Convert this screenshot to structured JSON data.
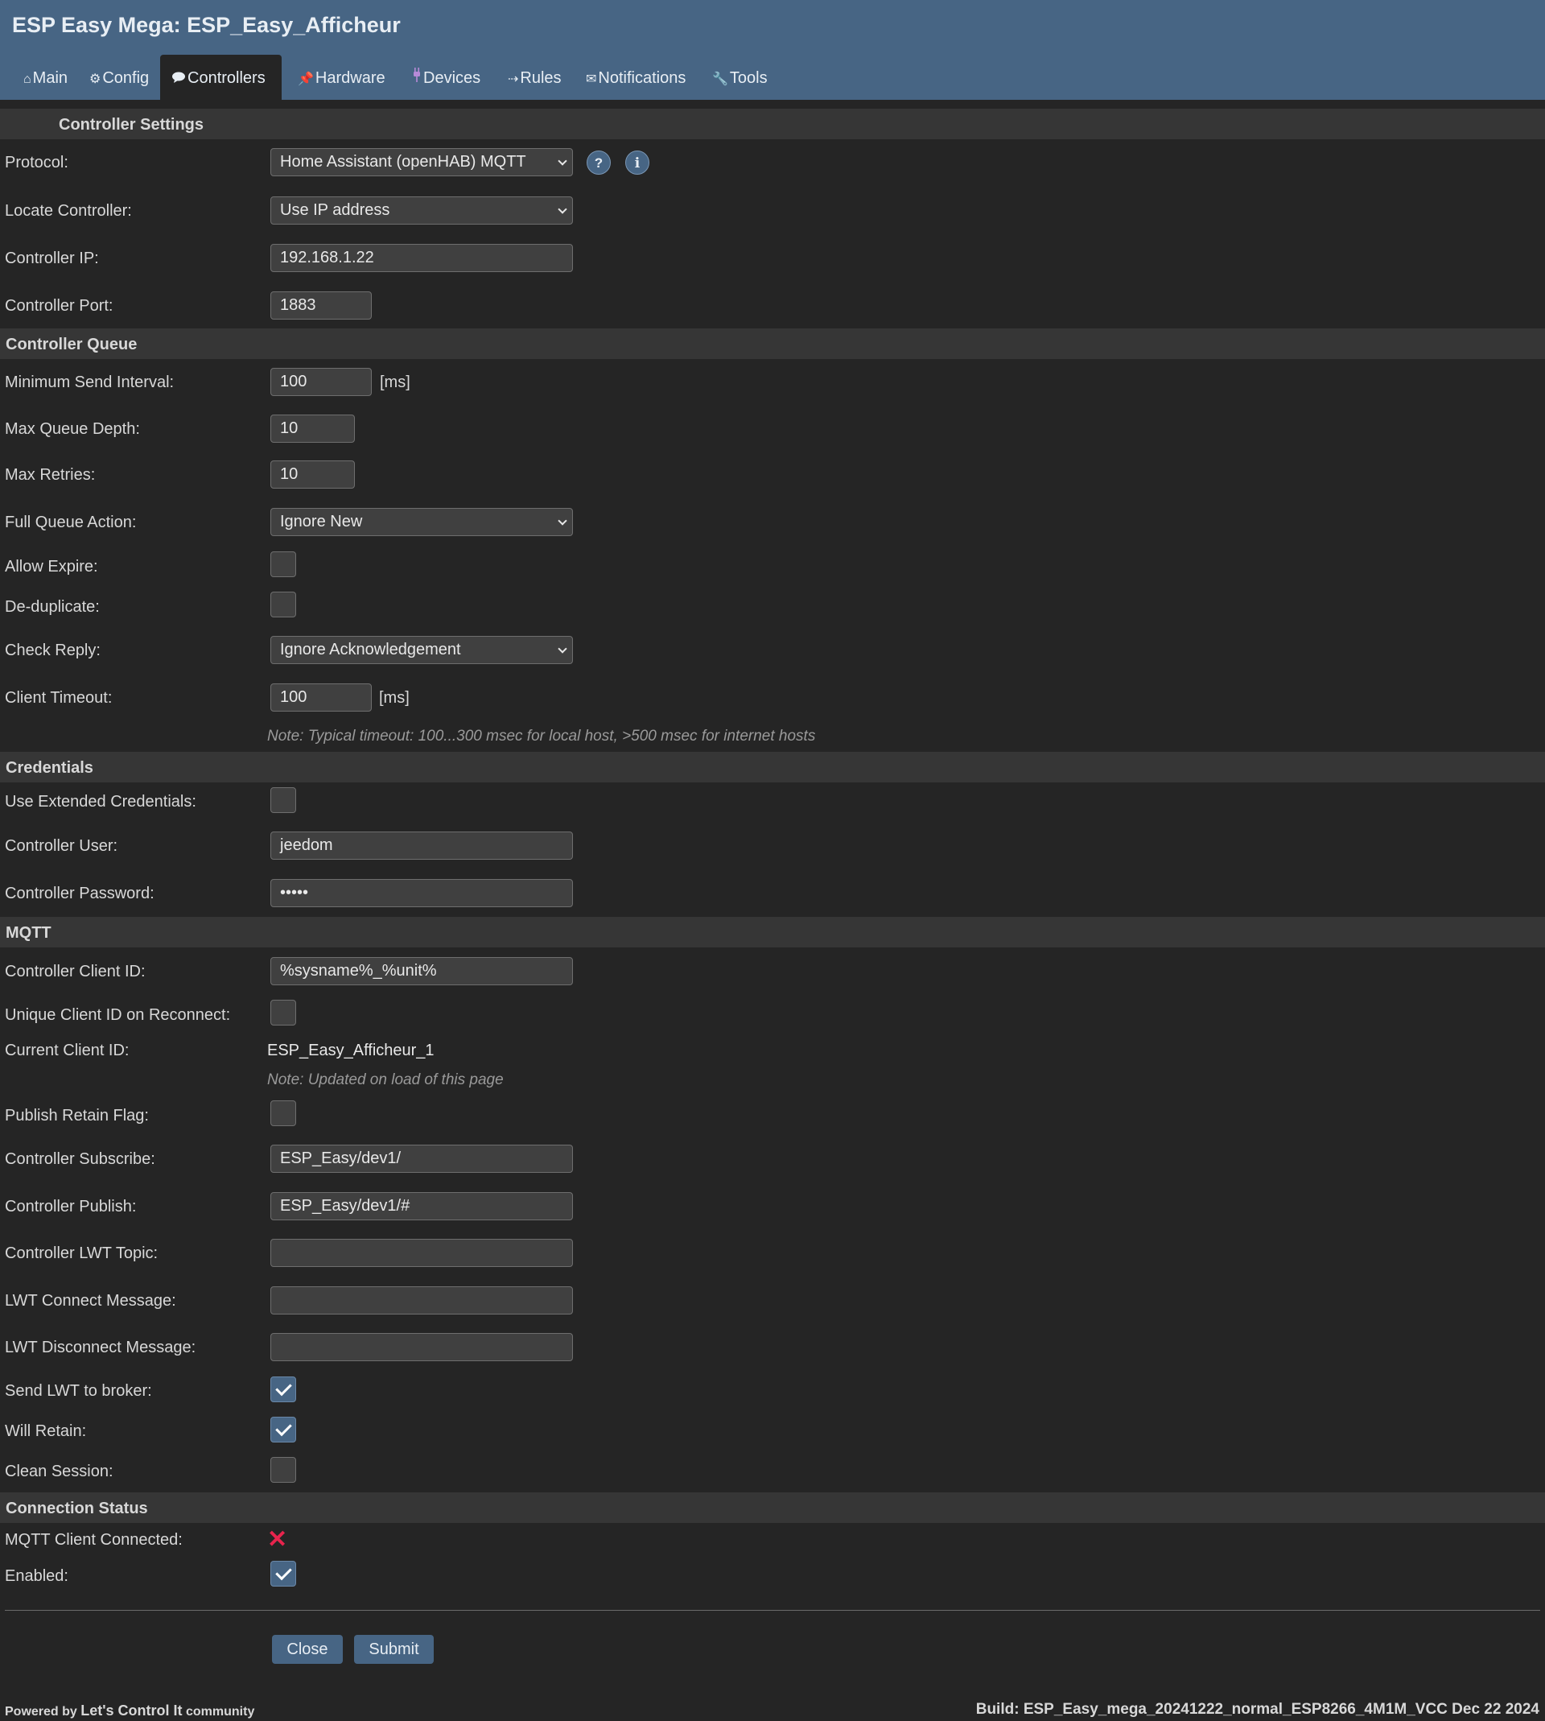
{
  "header": {
    "title": "ESP Easy Mega: ESP_Easy_Afficheur",
    "tabs": [
      {
        "label": "Main",
        "icon": "home-icon"
      },
      {
        "label": "Config",
        "icon": "gear-icon"
      },
      {
        "label": "Controllers",
        "icon": "speech-bubble-icon",
        "active": true
      },
      {
        "label": "Hardware",
        "icon": "pushpin-icon"
      },
      {
        "label": "Devices",
        "icon": "plug-icon"
      },
      {
        "label": "Rules",
        "icon": "arrow-icon"
      },
      {
        "label": "Notifications",
        "icon": "envelope-icon"
      },
      {
        "label": "Tools",
        "icon": "wrench-icon"
      }
    ]
  },
  "settings": {
    "heading": "Controller Settings",
    "protocol": {
      "label": "Protocol:",
      "value": "Home Assistant (openHAB) MQTT",
      "help": "?",
      "info": "i"
    },
    "locate": {
      "label": "Locate Controller:",
      "value": "Use IP address"
    },
    "ip": {
      "label": "Controller IP:",
      "value": "192.168.1.22"
    },
    "port": {
      "label": "Controller Port:",
      "value": "1883"
    }
  },
  "queue": {
    "heading": "Controller Queue",
    "min_interval": {
      "label": "Minimum Send Interval:",
      "value": "100",
      "unit": "[ms]"
    },
    "max_depth": {
      "label": "Max Queue Depth:",
      "value": "10"
    },
    "max_retries": {
      "label": "Max Retries:",
      "value": "10"
    },
    "full_action": {
      "label": "Full Queue Action:",
      "value": "Ignore New"
    },
    "allow_expire": {
      "label": "Allow Expire:",
      "checked": false
    },
    "dedup": {
      "label": "De-duplicate:",
      "checked": false
    },
    "check_reply": {
      "label": "Check Reply:",
      "value": "Ignore Acknowledgement"
    },
    "client_timeout": {
      "label": "Client Timeout:",
      "value": "100",
      "unit": "[ms]"
    },
    "timeout_note": "Note: Typical timeout: 100...300 msec for local host, >500 msec for internet hosts"
  },
  "credentials": {
    "heading": "Credentials",
    "extended": {
      "label": "Use Extended Credentials:",
      "checked": false
    },
    "user": {
      "label": "Controller User:",
      "value": "jeedom"
    },
    "password": {
      "label": "Controller Password:",
      "value": "•••••"
    }
  },
  "mqtt": {
    "heading": "MQTT",
    "client_id": {
      "label": "Controller Client ID:",
      "value": "%sysname%_%unit%"
    },
    "unique_id": {
      "label": "Unique Client ID on Reconnect:",
      "checked": false
    },
    "current_id": {
      "label": "Current Client ID:",
      "value": "ESP_Easy_Afficheur_1"
    },
    "current_note": "Note: Updated on load of this page",
    "retain": {
      "label": "Publish Retain Flag:",
      "checked": false
    },
    "subscribe": {
      "label": "Controller Subscribe:",
      "value": "ESP_Easy/dev1/"
    },
    "publish": {
      "label": "Controller Publish:",
      "value": "ESP_Easy/dev1/#"
    },
    "lwt_topic": {
      "label": "Controller LWT Topic:",
      "value": ""
    },
    "lwt_connect": {
      "label": "LWT Connect Message:",
      "value": ""
    },
    "lwt_disconnect": {
      "label": "LWT Disconnect Message:",
      "value": ""
    },
    "send_lwt": {
      "label": "Send LWT to broker:",
      "checked": true
    },
    "will_retain": {
      "label": "Will Retain:",
      "checked": true
    },
    "clean_session": {
      "label": "Clean Session:",
      "checked": false
    }
  },
  "status": {
    "heading": "Connection Status",
    "connected": {
      "label": "MQTT Client Connected:",
      "icon": "x-icon",
      "glyph": "✕"
    },
    "enabled": {
      "label": "Enabled:",
      "checked": true
    }
  },
  "buttons": {
    "close": "Close",
    "submit": "Submit"
  },
  "footer": {
    "powered_prefix": "Powered by",
    "community_name": "Let's Control It",
    "community_suffix": "community",
    "build": "Build: ESP_Easy_mega_20241222_normal_ESP8266_4M1M_VCC Dec 22 2024"
  },
  "colors": {
    "header": "#476584",
    "background": "#252525",
    "error": "#e8244d"
  }
}
